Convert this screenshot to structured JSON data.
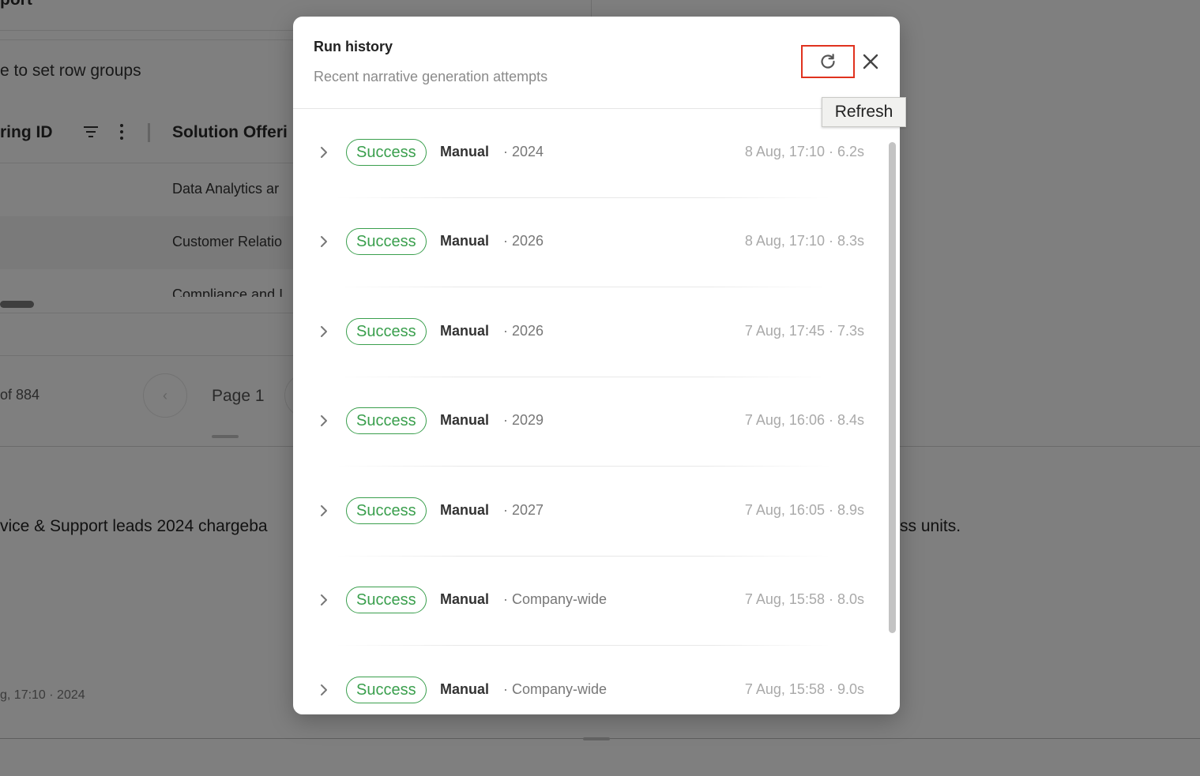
{
  "background": {
    "page_title_fragment": "port",
    "row_groups_hint": "e to set row groups",
    "columns": {
      "offering_id": "ring ID",
      "solution_offering": "Solution Offeri"
    },
    "rows": [
      "Data Analytics ar",
      "Customer Relatio",
      "Compliance and I"
    ],
    "pager": {
      "count": "of 884",
      "page": "Page 1",
      "prev": "‹"
    },
    "summary_left": "vice & Support leads 2024 chargeba",
    "summary_right": "ss units.",
    "meta": "g, 17:10 · 2024"
  },
  "modal": {
    "title": "Run history",
    "subtitle": "Recent narrative generation attempts",
    "refresh_icon": "refresh-icon",
    "close_icon": "close-icon",
    "tooltip": "Refresh",
    "accent_color": "#3a9f4d",
    "highlight_color": "#e0321e",
    "runs": [
      {
        "status": "Success",
        "trigger": "Manual",
        "scope": "· 2024",
        "meta": "8 Aug, 17:10 · 6.2s"
      },
      {
        "status": "Success",
        "trigger": "Manual",
        "scope": "· 2026",
        "meta": "8 Aug, 17:10 · 8.3s"
      },
      {
        "status": "Success",
        "trigger": "Manual",
        "scope": "· 2026",
        "meta": "7 Aug, 17:45 · 7.3s"
      },
      {
        "status": "Success",
        "trigger": "Manual",
        "scope": "· 2029",
        "meta": "7 Aug, 16:06 · 8.4s"
      },
      {
        "status": "Success",
        "trigger": "Manual",
        "scope": "· 2027",
        "meta": "7 Aug, 16:05 · 8.9s"
      },
      {
        "status": "Success",
        "trigger": "Manual",
        "scope": "· Company-wide",
        "meta": "7 Aug, 15:58 · 8.0s"
      },
      {
        "status": "Success",
        "trigger": "Manual",
        "scope": "· Company-wide",
        "meta": "7 Aug, 15:58 · 9.0s"
      }
    ]
  }
}
